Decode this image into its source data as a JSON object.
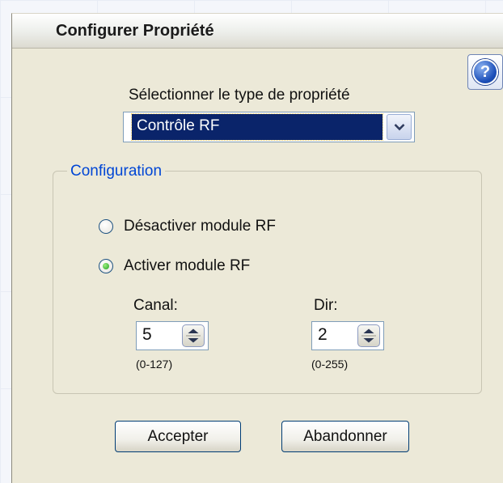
{
  "dialog": {
    "title": "Configurer Propriété",
    "help_icon": "help-question-icon"
  },
  "property_type": {
    "label": "Sélectionner le type de propriété",
    "selected": "Contrôle RF",
    "dropdown_icon": "chevron-down-icon"
  },
  "configuration": {
    "legend": "Configuration",
    "options": [
      {
        "label": "Désactiver module RF",
        "selected": false
      },
      {
        "label": "Activer module RF",
        "selected": true
      }
    ],
    "canal": {
      "label": "Canal:",
      "value": "5",
      "range": "(0-127)"
    },
    "dir": {
      "label": "Dir:",
      "value": "2",
      "range": "(0-255)"
    },
    "spinner_icon": "up-down-arrows-icon"
  },
  "buttons": {
    "accept": "Accepter",
    "cancel": "Abandonner"
  },
  "colors": {
    "dialog_bg": "#ece9d8",
    "selection_bg": "#0a246a",
    "legend_text": "#0046d5",
    "button_border": "#003c74"
  }
}
